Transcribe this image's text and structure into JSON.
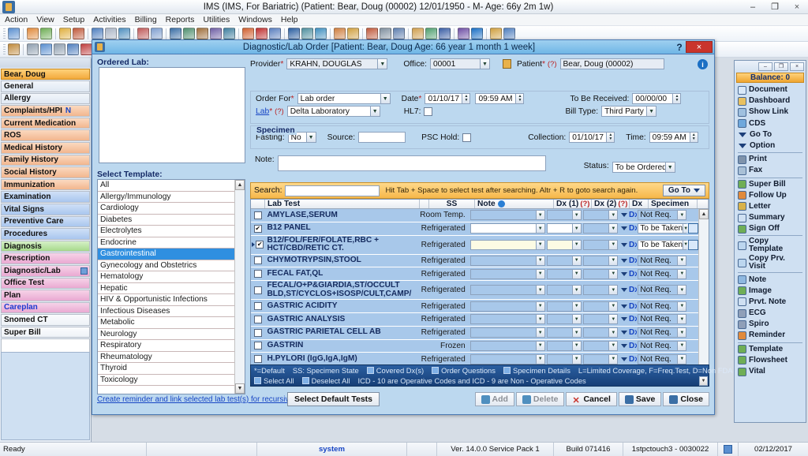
{
  "window": {
    "title": "IMS (IMS, For Bariatric)   (Patient: Bear, Doug  (00002) 12/01/1950 - M- Age: 66y 2m 1w)",
    "minimize": "–",
    "restore": "❐",
    "close": "×",
    "app_icon": "application-icon"
  },
  "menubar": [
    "Action",
    "View",
    "Setup",
    "Activities",
    "Billing",
    "Reports",
    "Utilities",
    "Windows",
    "Help"
  ],
  "toolbar_row1": [
    {
      "name": "patient-icon",
      "color": "#5a8fd0"
    },
    {
      "name": "add-patient-icon",
      "color": "#e08a3c"
    },
    {
      "name": "edit-patient-icon",
      "color": "#6fae56"
    },
    {
      "name": "appointment-icon",
      "color": "#e0b040"
    },
    {
      "name": "schedule-icon",
      "color": "#c05a3c"
    },
    {
      "name": "chart-icon",
      "color": "#4f7fbf"
    },
    {
      "name": "lab-flask-icon",
      "color": "#a9b4c4"
    },
    {
      "name": "shield-icon",
      "color": "#4f8fbf"
    },
    {
      "name": "note-icon",
      "color": "#c05a5a"
    },
    {
      "name": "document-icon",
      "color": "#7f9fcf"
    },
    {
      "name": "billing-icon",
      "color": "#3a6ea5"
    },
    {
      "name": "claim-icon",
      "color": "#4f8f6f"
    },
    {
      "name": "payment-icon",
      "color": "#9f6f3c"
    },
    {
      "name": "ledger-icon",
      "color": "#6f5fa5"
    },
    {
      "name": "statement-icon",
      "color": "#3f7f9f"
    },
    {
      "name": "calendar-icon",
      "color": "#d06030"
    },
    {
      "name": "person-run-icon",
      "color": "#c03030"
    },
    {
      "name": "report-icon",
      "color": "#5a7fbf"
    },
    {
      "name": "back-arrow-icon",
      "color": "#2a5ea0"
    },
    {
      "name": "refresh-icon",
      "color": "#4f8f9f"
    },
    {
      "name": "globe-icon",
      "color": "#3f8fbf"
    },
    {
      "name": "template-icon",
      "color": "#cf7f3f"
    },
    {
      "name": "copy-icon",
      "color": "#d0a040"
    },
    {
      "name": "graph-icon",
      "color": "#c05a3c"
    },
    {
      "name": "printer-icon",
      "color": "#7f8f9f"
    },
    {
      "name": "scan-icon",
      "color": "#5f7faf"
    },
    {
      "name": "letter-icon",
      "color": "#cf9f4f"
    },
    {
      "name": "export-icon",
      "color": "#4f9f6f"
    },
    {
      "name": "word-icon",
      "color": "#3a5ea5"
    },
    {
      "name": "signoff-icon",
      "color": "#6f4fa5"
    },
    {
      "name": "help-icon",
      "color": "#1a6fc4"
    },
    {
      "name": "lock-icon",
      "color": "#d0a040"
    },
    {
      "name": "logout-icon",
      "color": "#4f7fbf"
    }
  ],
  "toolbar_row2": [
    {
      "name": "hand-pointer-icon",
      "color": "#c08a3c"
    },
    {
      "name": "record-icon",
      "color": "#8f9fb0"
    },
    {
      "name": "edit-note-icon",
      "color": "#5a8fd0"
    },
    {
      "name": "stop-icon",
      "color": "#8f9fb0"
    },
    {
      "name": "print-preview-icon",
      "color": "#4f7fbf"
    },
    {
      "name": "hand-icon",
      "color": "#c04040"
    }
  ],
  "leftnav": {
    "patient": "Bear, Doug",
    "items": [
      {
        "label": "General",
        "style": "g-blue",
        "badge": "",
        "mini": false
      },
      {
        "label": "Allergy",
        "style": "g-blue",
        "badge": "",
        "mini": false
      },
      {
        "label": "Complaints/HPI",
        "style": "g-peach",
        "badge": "N",
        "mini": false
      },
      {
        "label": "Current Medication",
        "style": "g-peach",
        "badge": "",
        "mini": false
      },
      {
        "label": "ROS",
        "style": "g-peach",
        "badge": "",
        "mini": false
      },
      {
        "label": "Medical History",
        "style": "g-peach",
        "badge": "",
        "mini": false
      },
      {
        "label": "Family History",
        "style": "g-peach",
        "badge": "",
        "mini": false
      },
      {
        "label": "Social History",
        "style": "g-peach",
        "badge": "",
        "mini": false
      },
      {
        "label": "Immunization",
        "style": "g-peach",
        "badge": "",
        "mini": false
      },
      {
        "label": "Examination",
        "style": "g-lblue",
        "badge": "",
        "mini": false
      },
      {
        "label": "Vital Signs",
        "style": "g-lblue",
        "badge": "",
        "mini": false
      },
      {
        "label": "Preventive Care",
        "style": "g-lblue",
        "badge": "",
        "mini": false
      },
      {
        "label": "Procedures",
        "style": "g-lblue",
        "badge": "",
        "mini": false
      },
      {
        "label": "Diagnosis",
        "style": "g-green",
        "badge": "",
        "mini": false
      },
      {
        "label": "Prescription",
        "style": "g-pink",
        "badge": "",
        "mini": false
      },
      {
        "label": "Diagnostic/Lab",
        "style": "g-pink",
        "badge": "",
        "mini": true
      },
      {
        "label": "Office Test",
        "style": "g-pink",
        "badge": "",
        "mini": false
      },
      {
        "label": "Plan",
        "style": "g-pink",
        "badge": "",
        "mini": false
      },
      {
        "label": "Careplan",
        "style": "g-pink",
        "badge": "",
        "mini": false,
        "blue_text": true
      },
      {
        "label": "Snomed CT",
        "style": "g-white",
        "badge": "",
        "mini": false
      },
      {
        "label": "Super Bill",
        "style": "g-white",
        "badge": "",
        "mini": false
      }
    ]
  },
  "rightpanel": {
    "window_controls": {
      "minimize": "–",
      "restore": "❐",
      "close": "×"
    },
    "balance": "Balance: 0",
    "items": [
      {
        "label": "Document",
        "icon": "document-icon",
        "color": "#d9e8f8",
        "type": "icon"
      },
      {
        "label": "Dashboard",
        "icon": "dashboard-icon",
        "color": "#e8c060",
        "type": "icon"
      },
      {
        "label": "Show Link",
        "icon": "link-icon",
        "color": "#9fc0df",
        "type": "icon"
      },
      {
        "label": "CDS",
        "icon": "cds-icon",
        "color": "#6fa8dc",
        "type": "icon"
      },
      {
        "label": "Go To",
        "icon": "chevron-down-icon",
        "type": "tri"
      },
      {
        "label": "Option",
        "icon": "chevron-down-icon",
        "type": "tri"
      },
      {
        "label": "Print",
        "icon": "printer-icon",
        "color": "#7f93ab",
        "type": "icon",
        "sep_before": true
      },
      {
        "label": "Fax",
        "icon": "fax-icon",
        "color": "#a9c0d6",
        "type": "icon"
      },
      {
        "label": "Super Bill",
        "icon": "money-icon",
        "color": "#6fae56",
        "type": "icon",
        "sep_before": true
      },
      {
        "label": "Follow Up",
        "icon": "calendar-icon",
        "color": "#e08a3c",
        "type": "icon"
      },
      {
        "label": "Letter",
        "icon": "letter-icon",
        "color": "#d8b24a",
        "type": "icon"
      },
      {
        "label": "Summary",
        "icon": "summary-icon",
        "color": "#cfe0f2",
        "type": "icon"
      },
      {
        "label": "Sign Off",
        "icon": "signoff-icon",
        "color": "#6fae56",
        "type": "icon"
      },
      {
        "label": "Copy Template",
        "icon": "copy-icon",
        "color": "#bcd6ef",
        "type": "icon",
        "two_line": true,
        "sep_before": true
      },
      {
        "label": "Copy Prv. Visit",
        "icon": "copy-icon",
        "color": "#bcd6ef",
        "type": "icon",
        "two_line": true
      },
      {
        "label": "Note",
        "icon": "note-icon",
        "color": "#8fb8e0",
        "type": "icon",
        "sep_before": true
      },
      {
        "label": "Image",
        "icon": "image-icon",
        "color": "#6fae56",
        "type": "icon"
      },
      {
        "label": "Prvt. Note",
        "icon": "private-note-icon",
        "color": "#cfe0f2",
        "type": "icon"
      },
      {
        "label": "ECG",
        "icon": "ecg-icon",
        "color": "#8f9fb8",
        "type": "icon"
      },
      {
        "label": "Spiro",
        "icon": "spiro-icon",
        "color": "#8f9fb8",
        "type": "icon"
      },
      {
        "label": "Reminder",
        "icon": "reminder-icon",
        "color": "#e08a3c",
        "type": "icon"
      },
      {
        "label": "Template",
        "icon": "template-icon",
        "color": "#6fae56",
        "type": "icon",
        "sep_before": true
      },
      {
        "label": "Flowsheet",
        "icon": "flowsheet-icon",
        "color": "#6fae56",
        "type": "icon"
      },
      {
        "label": "Vital",
        "icon": "vital-icon",
        "color": "#6fae56",
        "type": "icon"
      }
    ]
  },
  "dialog": {
    "title": "Diagnostic/Lab Order  [Patient: Bear, Doug  Age: 66 year 1 month 1 week]",
    "help_label": "?",
    "close_label": "×",
    "ordered_lab_label": "Ordered Lab:",
    "select_template_label": "Select Template:",
    "templates": [
      {
        "label": "All",
        "selected": false
      },
      {
        "label": "Allergy/Immunology",
        "selected": false
      },
      {
        "label": "Cardiology",
        "selected": false
      },
      {
        "label": "Diabetes",
        "selected": false
      },
      {
        "label": "Electrolytes",
        "selected": false
      },
      {
        "label": "Endocrine",
        "selected": false
      },
      {
        "label": "Gastrointestinal",
        "selected": true
      },
      {
        "label": "Gynecology and Obstetrics",
        "selected": false
      },
      {
        "label": "Hematology",
        "selected": false
      },
      {
        "label": "Hepatic",
        "selected": false
      },
      {
        "label": "HIV & Opportunistic Infections",
        "selected": false
      },
      {
        "label": "Infectious Diseases",
        "selected": false
      },
      {
        "label": "Metabolic",
        "selected": false
      },
      {
        "label": "Neurology",
        "selected": false
      },
      {
        "label": "Respiratory",
        "selected": false
      },
      {
        "label": "Rheumatology",
        "selected": false
      },
      {
        "label": "Thyroid",
        "selected": false
      },
      {
        "label": "Toxicology",
        "selected": false
      }
    ],
    "form": {
      "provider_label": "Provider",
      "provider_value": "KRAHN, DOUGLAS",
      "office_label": "Office:",
      "office_value": "00001",
      "patient_label": "Patient",
      "patient_help": "(?)",
      "patient_value": "Bear, Doug  (00002)",
      "order_for_label": "Order For",
      "order_for_value": "Lab order",
      "date_label": "Date",
      "date_value": "01/10/17",
      "time_value": "09:59 AM",
      "to_be_received_label": "To Be Received:",
      "to_be_received_value": "00/00/00",
      "lab_label": "Lab",
      "lab_help": "(?)",
      "lab_value": "Delta Laboratory",
      "hl7_label": "HL7:",
      "bill_type_label": "Bill Type:",
      "bill_type_value": "Third Party",
      "specimen_label": "Specimen",
      "fasting_label": "Fasting:",
      "fasting_value": "No",
      "source_label": "Source:",
      "source_value": "",
      "psc_hold_label": "PSC Hold:",
      "collection_label": "Collection:",
      "collection_value": "01/10/17",
      "collection_time_label": "Time:",
      "collection_time_value": "09:59 AM",
      "note_label": "Note:",
      "note_value": "",
      "status_label": "Status:",
      "status_value": "To be Ordered",
      "required_mark": "*"
    },
    "search": {
      "label": "Search:",
      "value": "",
      "hint": "Hit Tab + Space to select test after searching. Altr + R to goto search again.",
      "goto_label": "Go To"
    },
    "table": {
      "columns": [
        "",
        "Lab Test",
        "",
        "SS",
        "Note",
        "Dx (1)",
        "(?)",
        "Dx (2)",
        "(?)",
        "Dx",
        "Specimen",
        ""
      ],
      "rows": [
        {
          "checked": false,
          "test": "AMYLASE,SERUM",
          "ss": "Room Temp.",
          "note": "",
          "note_style": "plain",
          "dx1": "",
          "dx1_style": "plain",
          "specimen": "Not Req.",
          "extra": false
        },
        {
          "checked": true,
          "test": "B12 PANEL",
          "ss": "Refrigerated",
          "note": "",
          "note_style": "lit",
          "dx1": "",
          "dx1_style": "lit",
          "specimen": "To be Taken",
          "extra": true
        },
        {
          "checked": true,
          "test": "B12/FOL/FER/FOLATE,RBC + HCT/CBD/RETIC CT.",
          "ss": "Refrigerated",
          "note": "",
          "note_style": "cream",
          "dx1": "",
          "dx1_style": "cream",
          "specimen": "To be Taken",
          "extra": true,
          "tall": true,
          "marker": true
        },
        {
          "checked": false,
          "test": "CHYMOTRYPSIN,STOOL",
          "ss": "Refrigerated",
          "note": "",
          "note_style": "plain",
          "dx1": "",
          "dx1_style": "plain",
          "specimen": "Not Req.",
          "extra": false
        },
        {
          "checked": false,
          "test": "FECAL FAT,QL",
          "ss": "Refrigerated",
          "note": "",
          "note_style": "plain",
          "dx1": "",
          "dx1_style": "plain",
          "specimen": "Not Req.",
          "extra": false
        },
        {
          "checked": false,
          "test": "FECAL/O+P&GIARDIA,ST/OCCULT BLD,ST/CYCLOS+ISOSP/CULT,CAMP/",
          "ss": "Refrigerated",
          "note": "",
          "note_style": "plain",
          "dx1": "",
          "dx1_style": "plain",
          "specimen": "Not Req.",
          "extra": false,
          "tall": true
        },
        {
          "checked": false,
          "test": "GASTRIC ACIDITY",
          "ss": "Refrigerated",
          "note": "",
          "note_style": "plain",
          "dx1": "",
          "dx1_style": "plain",
          "specimen": "Not Req.",
          "extra": false
        },
        {
          "checked": false,
          "test": "GASTRIC ANALYSIS",
          "ss": "Refrigerated",
          "note": "",
          "note_style": "plain",
          "dx1": "",
          "dx1_style": "plain",
          "specimen": "Not Req.",
          "extra": false
        },
        {
          "checked": false,
          "test": "GASTRIC PARIETAL CELL AB",
          "ss": "Refrigerated",
          "note": "",
          "note_style": "plain",
          "dx1": "",
          "dx1_style": "plain",
          "specimen": "Not Req.",
          "extra": false
        },
        {
          "checked": false,
          "test": "GASTRIN",
          "ss": "Frozen",
          "note": "",
          "note_style": "plain",
          "dx1": "",
          "dx1_style": "plain",
          "specimen": "Not Req.",
          "extra": false
        },
        {
          "checked": false,
          "test": "H.PYLORI (IgG,IgA,IgM)",
          "ss": "Refrigerated",
          "note": "",
          "note_style": "plain",
          "dx1": "",
          "dx1_style": "plain",
          "specimen": "Not Req.",
          "extra": false
        }
      ],
      "dx_link_label": "Dx"
    },
    "legend": {
      "line1": [
        {
          "text": "*=Default",
          "icon": false
        },
        {
          "text": "SS: Specimen State",
          "icon": false
        },
        {
          "text": "Covered Dx(s)",
          "icon": true,
          "icon_name": "covered-dx-icon"
        },
        {
          "text": "Order Questions",
          "icon": true,
          "icon_name": "order-questions-icon"
        },
        {
          "text": "Specimen Details",
          "icon": true,
          "icon_name": "specimen-details-icon"
        },
        {
          "text": "L=Limited Coverage, F=Freq.Test, D=Non FDA",
          "icon": false
        }
      ],
      "line2": [
        {
          "text": "Select All",
          "icon": true,
          "icon_name": "select-all-icon"
        },
        {
          "text": "Deselect All",
          "icon": true,
          "icon_name": "deselect-all-icon"
        },
        {
          "text": "ICD - 10 are Operative Codes and ICD - 9 are Non - Operative Codes",
          "icon": false
        }
      ]
    },
    "footer": {
      "recursive_link": "Create reminder and link selected lab test(s) for recursive order.",
      "select_default_tests": "Select Default Tests",
      "buttons": [
        {
          "label": "Add",
          "icon": "add-icon",
          "color": "#4f8fbf",
          "dim": true
        },
        {
          "label": "Delete",
          "icon": "delete-icon",
          "color": "#4f8fbf",
          "dim": true
        },
        {
          "label": "Cancel",
          "icon": "cancel-icon",
          "color": "#c9342c",
          "dim": false
        },
        {
          "label": "Save",
          "icon": "save-icon",
          "color": "#3a6ea5",
          "dim": false
        },
        {
          "label": "Close",
          "icon": "close-icon",
          "color": "#3a6ea5",
          "dim": false
        }
      ]
    }
  },
  "statusbar": {
    "ready": "Ready",
    "blank1": "",
    "system": "system",
    "blank2": "",
    "version": "Ver. 14.0.0 Service Pack 1",
    "build": "Build 071416",
    "machine": "1stpctouch3 - 0030022",
    "tray_icon": "tray-icon",
    "date": "02/12/2017"
  }
}
